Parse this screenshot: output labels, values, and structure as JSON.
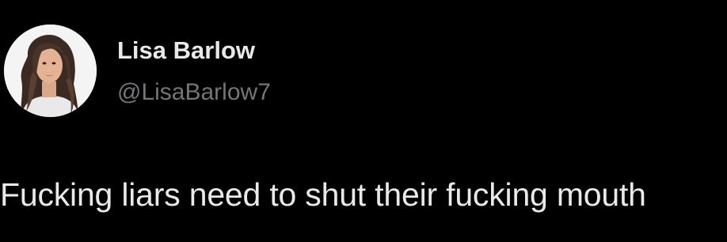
{
  "author": {
    "display_name": "Lisa Barlow",
    "handle": "@LisaBarlow7",
    "avatar_icon": "profile-photo"
  },
  "tweet": {
    "text": "Fucking liars need to shut their fucking mouth"
  },
  "colors": {
    "background": "#000000",
    "primary_text": "#e7e9ea",
    "secondary_text": "#71767b"
  }
}
